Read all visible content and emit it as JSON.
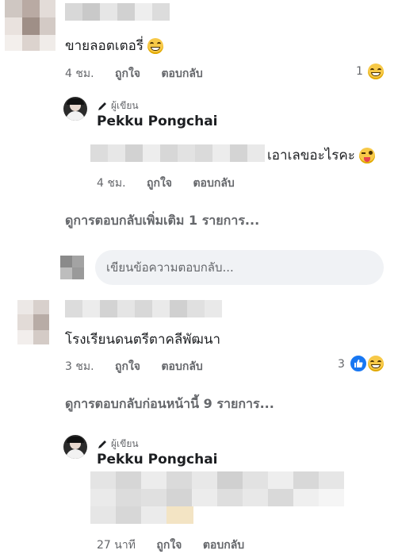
{
  "comments": [
    {
      "text": "ขายลอตเตอรี่",
      "time": "4 ชม.",
      "like_label": "ถูกใจ",
      "reply_label": "ตอบกลับ",
      "reaction_count": "1",
      "reaction_icon": "laughing-emoji"
    },
    {
      "badge_label": "ผู้เขียน",
      "author": "Pekku Pongchai",
      "text": "เอาเลขอะไรคะ",
      "time": "4 ชม.",
      "like_label": "ถูกใจ",
      "reply_label": "ตอบกลับ",
      "emoji_icon": "winking-tongue-emoji"
    },
    {
      "text": "โรงเรียนดนตรีตาคลีพัฒนา",
      "time": "3 ชม.",
      "like_label": "ถูกใจ",
      "reply_label": "ตอบกลับ",
      "reaction_count": "3",
      "reaction_icons": [
        "like-icon",
        "laughing-emoji"
      ]
    },
    {
      "badge_label": "ผู้เขียน",
      "author": "Pekku Pongchai",
      "time": "27 นาที",
      "like_label": "ถูกใจ",
      "reply_label": "ตอบกลับ"
    }
  ],
  "view_more_replies_1": "ดูการตอบกลับเพิ่มเติม 1 รายการ...",
  "reply_placeholder": "เขียนข้อความตอบกลับ...",
  "view_previous_replies": "ดูการตอบกลับก่อนหน้านี้ 9 รายการ...",
  "colors": {
    "meta_gray": "#65676b",
    "text": "#1c1e21",
    "input_bg": "#f0f2f5",
    "like_blue": "#1877f2"
  }
}
